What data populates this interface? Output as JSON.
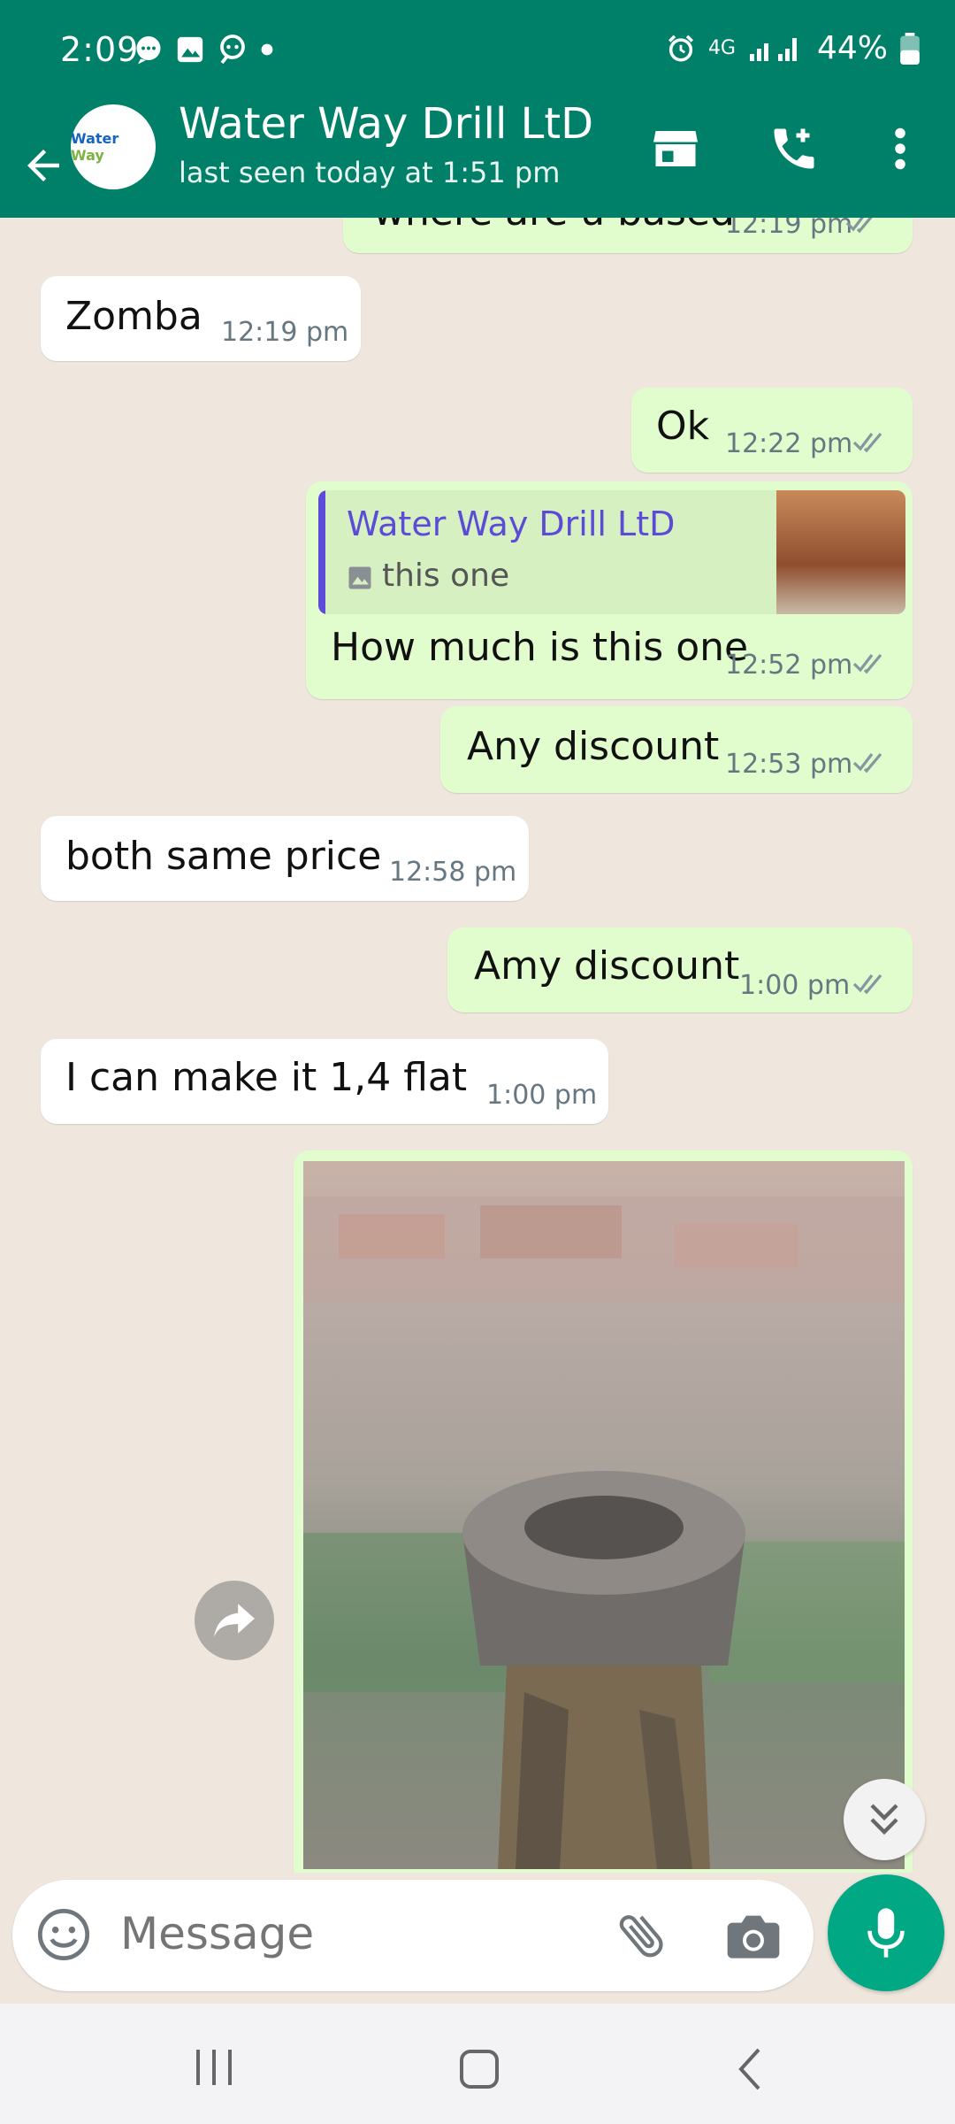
{
  "status_bar": {
    "time": "2:09",
    "network": "4G",
    "battery": "44%",
    "icons": [
      "chat-bubble-icon",
      "gallery-icon",
      "assistant-icon",
      "dot-icon",
      "alarm-icon",
      "signal-icon",
      "battery-icon"
    ]
  },
  "header": {
    "contact_name": "Water Way Drill LtD",
    "last_seen": "last seen today at 1:51 pm",
    "avatar_text_a": "Water",
    "avatar_text_b": "Way",
    "icons": [
      "back-arrow-icon",
      "shop-icon",
      "add-call-icon",
      "more-vert-icon"
    ]
  },
  "messages": [
    {
      "side": "out",
      "text": "where are u based",
      "time": "12:19 pm",
      "read": true
    },
    {
      "side": "in",
      "text": "Zomba",
      "time": "12:19 pm"
    },
    {
      "side": "out",
      "text": "Ok",
      "time": "12:22 pm",
      "read": true
    },
    {
      "side": "out",
      "reply_to": {
        "name": "Water Way Drill LtD",
        "snippet": "this one"
      },
      "text": "How much is this one",
      "time": "12:52 pm",
      "read": true
    },
    {
      "side": "out",
      "text": "Any discount",
      "time": "12:53 pm",
      "read": true
    },
    {
      "side": "in",
      "text": "both same price",
      "time": "12:58 pm"
    },
    {
      "side": "out",
      "text": "Amy discount",
      "time": "1:00 pm",
      "read": true
    },
    {
      "side": "in",
      "text": "I can make it 1,4 flat",
      "time": "1:00 pm"
    },
    {
      "side": "in",
      "type": "photo"
    }
  ],
  "composer": {
    "placeholder": "Message",
    "icons": [
      "emoji-icon",
      "attach-icon",
      "camera-icon",
      "mic-icon"
    ]
  },
  "nav": {
    "icons": [
      "recents-icon",
      "home-icon",
      "back-icon"
    ]
  },
  "colors": {
    "header": "#008069",
    "outgoing_bubble": "#e1fccd",
    "incoming_bubble": "#ffffff",
    "wallpaper": "#efe7dd",
    "accent": "#00a884",
    "read_ticks": "#8696a0"
  }
}
